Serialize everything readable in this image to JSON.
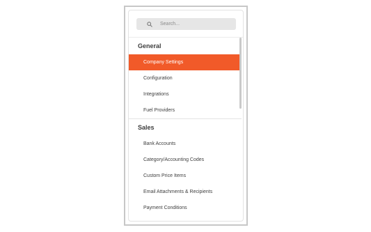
{
  "search": {
    "placeholder": "Search..."
  },
  "sections": [
    {
      "title": "General",
      "items": [
        "Company Settings",
        "Configuration",
        "Integrations",
        "Fuel Providers"
      ],
      "active_item": "Company Settings"
    },
    {
      "title": "Sales",
      "items": [
        "Bank Accounts",
        "Category/Accounting Codes",
        "Custom Price Items",
        "Email Attachments & Recipients",
        "Payment Conditions"
      ]
    }
  ],
  "icons": {
    "search": "search-icon"
  },
  "colors": {
    "accent": "#f15a29",
    "search_bg": "#e6e6e6",
    "frame_border": "#c7c7c7"
  }
}
